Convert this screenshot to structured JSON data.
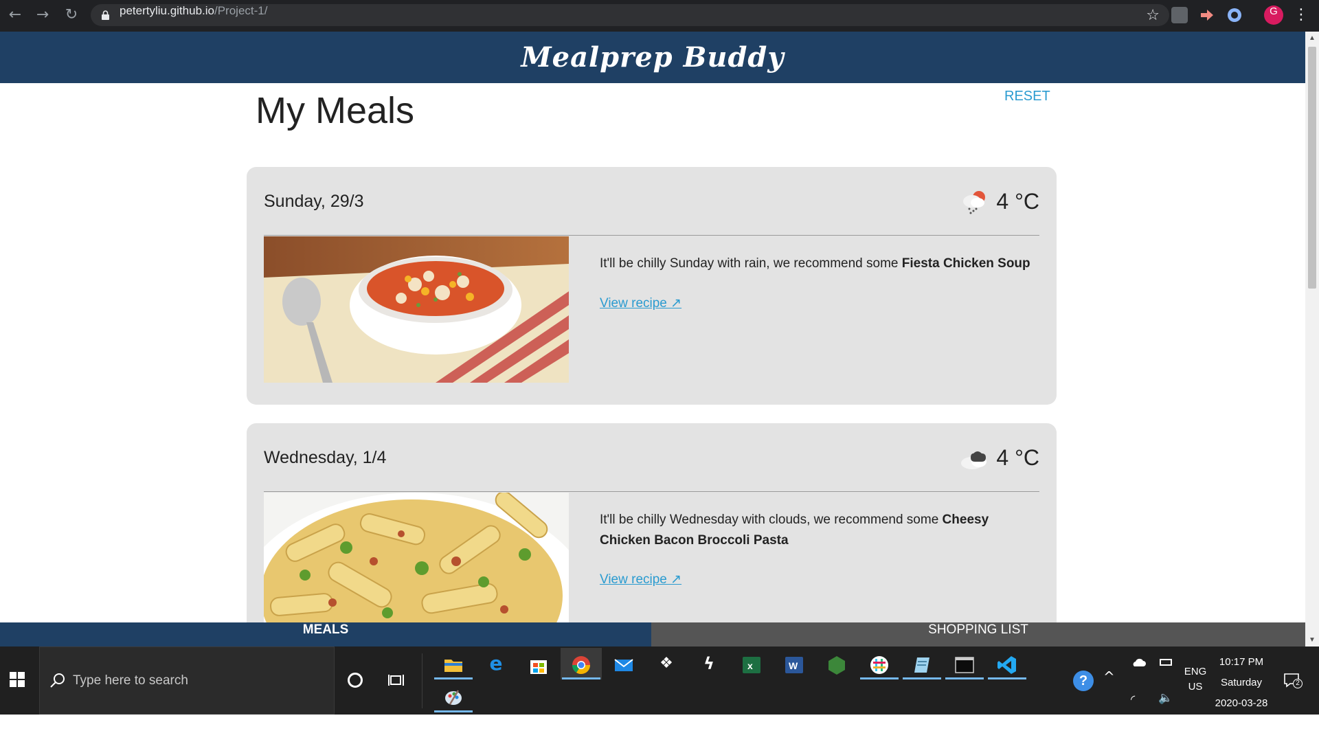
{
  "browser": {
    "url_host": "petertyliu.github.io",
    "url_path": "/Project-1/",
    "profile_initial": "G"
  },
  "app": {
    "brand": "Mealprep Buddy",
    "title": "My Meals",
    "reset_label": "RESET",
    "accent_color": "#1f4064",
    "link_color": "#2a9bd0"
  },
  "meals": [
    {
      "day": "Sunday, 29/3",
      "weather_icon": "rain-icon",
      "temp": "4 °C",
      "text_prefix": "It'll be chilly Sunday with rain, we recommend some ",
      "dish": "Fiesta Chicken Soup",
      "link": "View recipe ↗"
    },
    {
      "day": "Wednesday, 1/4",
      "weather_icon": "clouds-icon",
      "temp": "4 °C",
      "text_prefix": "It'll be chilly Wednesday with clouds, we recommend some ",
      "dish": "Cheesy Chicken Bacon Broccoli Pasta",
      "link": "View recipe ↗"
    }
  ],
  "tabs": {
    "meals": "MEALS",
    "shopping": "SHOPPING LIST"
  },
  "taskbar": {
    "search_placeholder": "Type here to search",
    "lang_line1": "ENG",
    "lang_line2": "US",
    "time": "10:17 PM",
    "weekday": "Saturday",
    "date": "2020-03-28",
    "notification_count": "2"
  }
}
